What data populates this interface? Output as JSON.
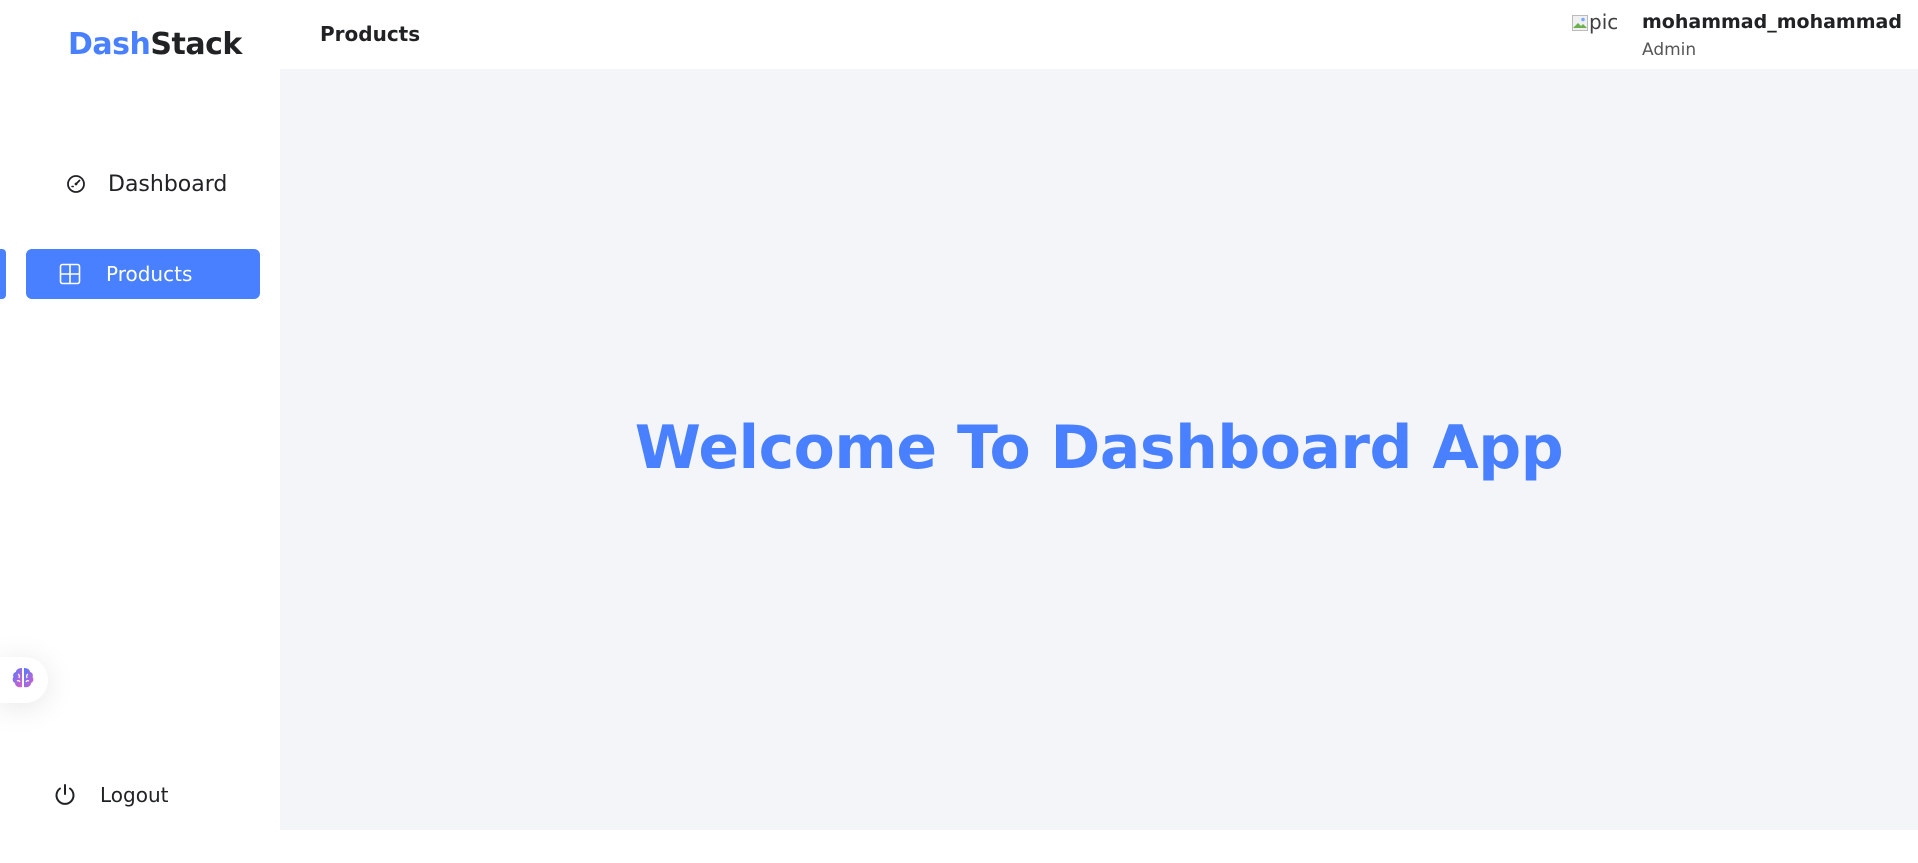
{
  "app": {
    "brand_part1": "Dash",
    "brand_part2": "Stack",
    "accent_color": "#4880FF",
    "background_color": "#F4F5F9"
  },
  "sidebar": {
    "items": [
      {
        "label": "Dashboard",
        "icon": "gauge-icon",
        "active": false
      },
      {
        "label": "Products",
        "icon": "grid-icon",
        "active": true
      }
    ],
    "floating_button_icon": "brain-icon",
    "logout": {
      "label": "Logout",
      "icon": "power-icon"
    }
  },
  "header": {
    "title": "Products",
    "avatar_alt": "pic",
    "user_name": "mohammad_mohammad",
    "user_role": "Admin"
  },
  "main": {
    "welcome_text": "Welcome To Dashboard App"
  }
}
